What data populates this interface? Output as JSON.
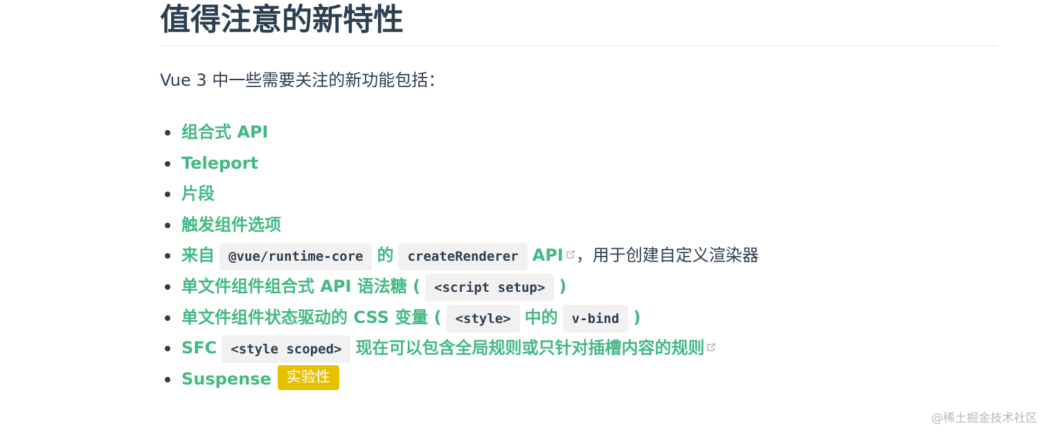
{
  "heading": "值得注意的新特性",
  "intro": "Vue 3 中一些需要关注的新功能包括：",
  "features": [
    {
      "link": "组合式 API"
    },
    {
      "link": "Teleport"
    },
    {
      "link": "片段"
    },
    {
      "link": "触发组件选项"
    },
    {
      "link_part1": "来自",
      "code1": "@vue/runtime-core",
      "link_part2": "的",
      "code2": "createRenderer",
      "link_part3": "API",
      "external_icon": "external-link-icon",
      "plain_suffix": "，用于创建自定义渲染器"
    },
    {
      "link_part1": "单文件组件组合式 API 语法糖 (",
      "code1": "<script setup>",
      "link_part2": ")"
    },
    {
      "link_part1": "单文件组件状态驱动的 CSS 变量 (",
      "code1": "<style>",
      "link_part2": "中的",
      "code2": "v-bind",
      "link_part3": ")"
    },
    {
      "link_part1": "SFC",
      "code1": "<style scoped>",
      "link_part2": "现在可以包含全局规则或只针对插槽内容的规则",
      "external_icon": "external-link-icon"
    },
    {
      "link": "Suspense",
      "badge": "实验性"
    }
  ],
  "watermark": "@稀土掘金技术社区",
  "colors": {
    "link": "#42b983",
    "text": "#2c3e50",
    "badge": "#e7c000",
    "code_bg": "#f1f1f1"
  }
}
